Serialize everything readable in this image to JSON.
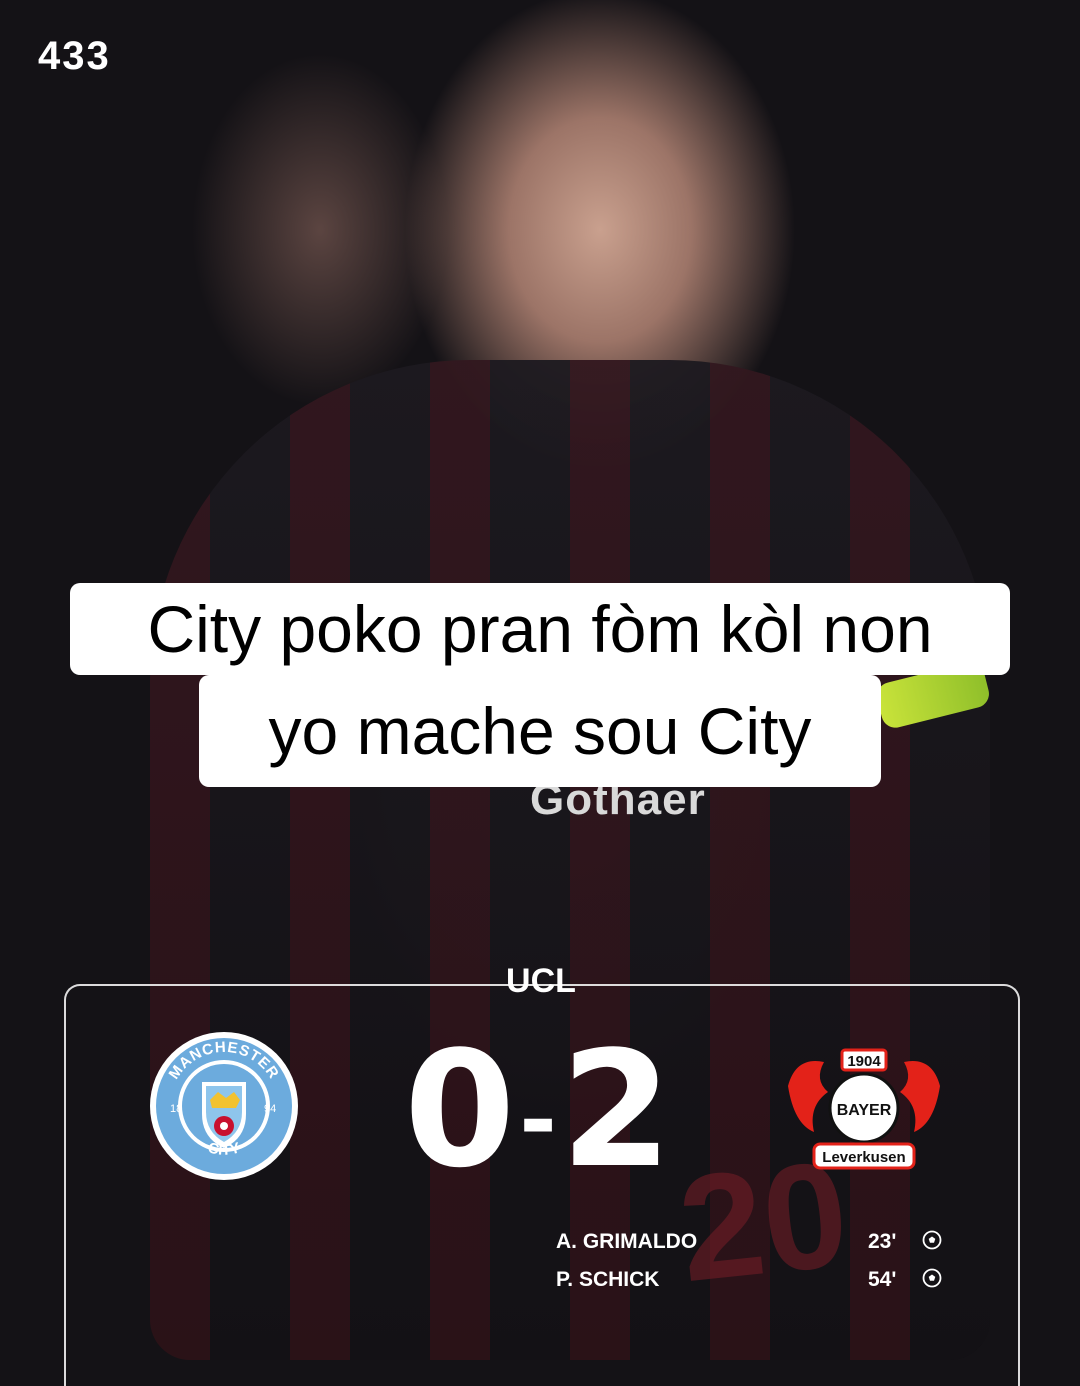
{
  "brand": {
    "logo_text": "433"
  },
  "caption": {
    "line1": "City poko pran fòm kòl non",
    "line2": "yo mache sou  City"
  },
  "background": {
    "sponsor_text": "Gothaer",
    "shirt_number": "20"
  },
  "match": {
    "competition": "UCL",
    "home_score": "0",
    "separator": "-",
    "away_score": "2",
    "home_crest": {
      "icon": "manchester-city-crest-icon",
      "top_text": "MANCHESTER",
      "bottom_text": "CITY",
      "year_left": "18",
      "year_right": "94",
      "color": "#6CABDD"
    },
    "away_crest": {
      "icon": "bayer-leverkusen-crest-icon",
      "year": "1904",
      "center_text": "BAYER",
      "bottom_text": "Leverkusen",
      "color": "#E32219"
    },
    "scorers": [
      {
        "name": "A. GRIMALDO",
        "minute": "23'",
        "icon": "football-icon"
      },
      {
        "name": "P. SCHICK",
        "minute": "54'",
        "icon": "football-icon"
      }
    ]
  }
}
